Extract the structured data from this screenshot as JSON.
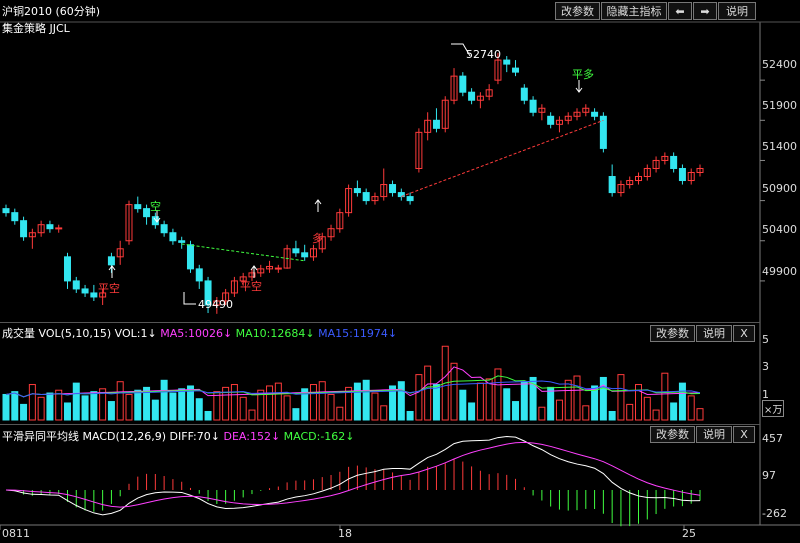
{
  "header": {
    "title": "沪铜2010 (60分钟)",
    "strategy": "集金策略 JJCL",
    "buttons": {
      "params": "改参数",
      "hide": "隐藏主指标",
      "left": "⬅",
      "right": "➡",
      "help": "说明"
    }
  },
  "colors": {
    "up": "#ff3b3b",
    "down": "#33e6f0",
    "ma_dash": "#ff3b3b",
    "vol_ma5": "#ff40ff",
    "vol_ma10": "#40ff40",
    "vol_ma15": "#3b5bff",
    "diff": "#ffffff",
    "dea": "#ff40ff",
    "macd_up": "#ff3b3b",
    "macd_down": "#40ff40"
  },
  "chart_data": [
    {
      "type": "candlestick",
      "y_ticks": [
        "52400",
        "51900",
        "51400",
        "50900",
        "50400",
        "49900"
      ],
      "ylim": [
        49600,
        52900
      ],
      "x_ticks": [
        "0811",
        "18",
        "25"
      ],
      "annotations": [
        {
          "text": "52740"
        },
        {
          "text": "49490"
        },
        {
          "text": "平空"
        },
        {
          "text": "平空"
        },
        {
          "text": "空"
        },
        {
          "text": "多"
        },
        {
          "text": "平多"
        }
      ],
      "candles": [
        [
          50800,
          50850,
          50700,
          50750
        ],
        [
          50750,
          50800,
          50600,
          50650
        ],
        [
          50650,
          50700,
          50400,
          50450
        ],
        [
          50450,
          50550,
          50300,
          50500
        ],
        [
          50500,
          50650,
          50450,
          50600
        ],
        [
          50600,
          50650,
          50500,
          50550
        ],
        [
          50550,
          50600,
          50500,
          50560
        ],
        [
          50200,
          50250,
          49800,
          49900
        ],
        [
          49900,
          49950,
          49750,
          49800
        ],
        [
          49800,
          49850,
          49700,
          49750
        ],
        [
          49750,
          49850,
          49650,
          49700
        ],
        [
          49700,
          49800,
          49600,
          49750
        ],
        [
          50200,
          50250,
          50000,
          50100
        ],
        [
          50200,
          50400,
          50100,
          50300
        ],
        [
          50400,
          50900,
          50350,
          50850
        ],
        [
          50850,
          50950,
          50750,
          50800
        ],
        [
          50800,
          50850,
          50600,
          50700
        ],
        [
          50700,
          50750,
          50550,
          50600
        ],
        [
          50600,
          50650,
          50450,
          50500
        ],
        [
          50500,
          50550,
          50350,
          50400
        ],
        [
          50400,
          50450,
          50300,
          50380
        ],
        [
          50350,
          50400,
          50000,
          50050
        ],
        [
          50050,
          50100,
          49800,
          49900
        ],
        [
          49900,
          49950,
          49500,
          49600
        ],
        [
          49600,
          49700,
          49490,
          49650
        ],
        [
          49650,
          49800,
          49600,
          49750
        ],
        [
          49750,
          49950,
          49700,
          49900
        ],
        [
          49900,
          50000,
          49850,
          49950
        ],
        [
          49950,
          50050,
          49900,
          50000
        ],
        [
          50000,
          50100,
          49950,
          50050
        ],
        [
          50050,
          50150,
          50000,
          50080
        ],
        [
          50050,
          50100,
          50000,
          50060
        ],
        [
          50060,
          50350,
          50050,
          50300
        ],
        [
          50300,
          50400,
          50200,
          50250
        ],
        [
          50250,
          50350,
          50150,
          50200
        ],
        [
          50200,
          50350,
          50150,
          50300
        ],
        [
          50300,
          50500,
          50250,
          50450
        ],
        [
          50450,
          50600,
          50400,
          50550
        ],
        [
          50550,
          50800,
          50500,
          50750
        ],
        [
          50750,
          51100,
          50700,
          51050
        ],
        [
          51050,
          51150,
          50950,
          51000
        ],
        [
          51000,
          51050,
          50850,
          50900
        ],
        [
          50900,
          51000,
          50850,
          50950
        ],
        [
          50950,
          51300,
          50900,
          51100
        ],
        [
          51100,
          51150,
          50950,
          51000
        ],
        [
          51000,
          51050,
          50900,
          50950
        ],
        [
          50950,
          51000,
          50850,
          50900
        ],
        [
          51300,
          51800,
          51250,
          51750
        ],
        [
          51750,
          52000,
          51650,
          51900
        ],
        [
          51900,
          52050,
          51750,
          51800
        ],
        [
          51800,
          52200,
          51750,
          52150
        ],
        [
          52150,
          52550,
          52100,
          52450
        ],
        [
          52450,
          52500,
          52200,
          52250
        ],
        [
          52250,
          52300,
          52100,
          52150
        ],
        [
          52150,
          52250,
          52050,
          52200
        ],
        [
          52200,
          52350,
          52150,
          52280
        ],
        [
          52400,
          52740,
          52350,
          52650
        ],
        [
          52650,
          52700,
          52500,
          52600
        ],
        [
          52550,
          52650,
          52450,
          52500
        ],
        [
          52300,
          52350,
          52100,
          52150
        ],
        [
          52150,
          52200,
          51950,
          52000
        ],
        [
          52000,
          52100,
          51900,
          52050
        ],
        [
          51950,
          52000,
          51800,
          51850
        ],
        [
          51850,
          51950,
          51750,
          51900
        ],
        [
          51900,
          52000,
          51850,
          51950
        ],
        [
          51950,
          52050,
          51900,
          52000
        ],
        [
          52000,
          52100,
          51950,
          52050
        ],
        [
          52000,
          52050,
          51900,
          51950
        ],
        [
          51950,
          52000,
          51500,
          51550
        ],
        [
          51200,
          51350,
          50950,
          51000
        ],
        [
          51000,
          51150,
          50950,
          51100
        ],
        [
          51100,
          51200,
          51050,
          51150
        ],
        [
          51150,
          51250,
          51100,
          51200
        ],
        [
          51200,
          51350,
          51150,
          51300
        ],
        [
          51300,
          51450,
          51250,
          51400
        ],
        [
          51400,
          51500,
          51350,
          51450
        ],
        [
          51450,
          51500,
          51250,
          51300
        ],
        [
          51300,
          51350,
          51100,
          51150
        ],
        [
          51150,
          51300,
          51100,
          51250
        ],
        [
          51250,
          51350,
          51200,
          51300
        ]
      ]
    },
    {
      "type": "bar",
      "title": "成交量 VOL(5,10,15) VOL:1↓",
      "legend": [
        {
          "name": "MA5:10026↓"
        },
        {
          "name": "MA10:12684↓"
        },
        {
          "name": "MA15:11974↓"
        }
      ],
      "y_ticks": [
        "5",
        "3",
        "1"
      ],
      "unit": "×万"
    },
    {
      "type": "bar",
      "title": "平滑异同平均线 MACD(12,26,9) DIFF:70↓",
      "legend": [
        {
          "name": "DEA:152↓"
        },
        {
          "name": "MACD:-162↓"
        }
      ],
      "y_ticks": [
        "457",
        "97",
        "-262"
      ]
    }
  ],
  "panels": {
    "vol": {
      "title": "成交量 VOL(5,10,15) VOL:1↓",
      "ma5": "MA5:10026↓",
      "ma10": "MA10:12684↓",
      "ma15": "MA15:11974↓",
      "params": "改参数",
      "help": "说明",
      "close": "X",
      "unit": "×万",
      "ticks": [
        "5",
        "3",
        "1"
      ]
    },
    "macd": {
      "title": "平滑异同平均线 MACD(12,26,9) DIFF:70↓",
      "dea": "DEA:152↓",
      "macd": "MACD:-162↓",
      "params": "改参数",
      "help": "说明",
      "close": "X",
      "ticks": [
        "457",
        "97",
        "-262"
      ]
    }
  }
}
